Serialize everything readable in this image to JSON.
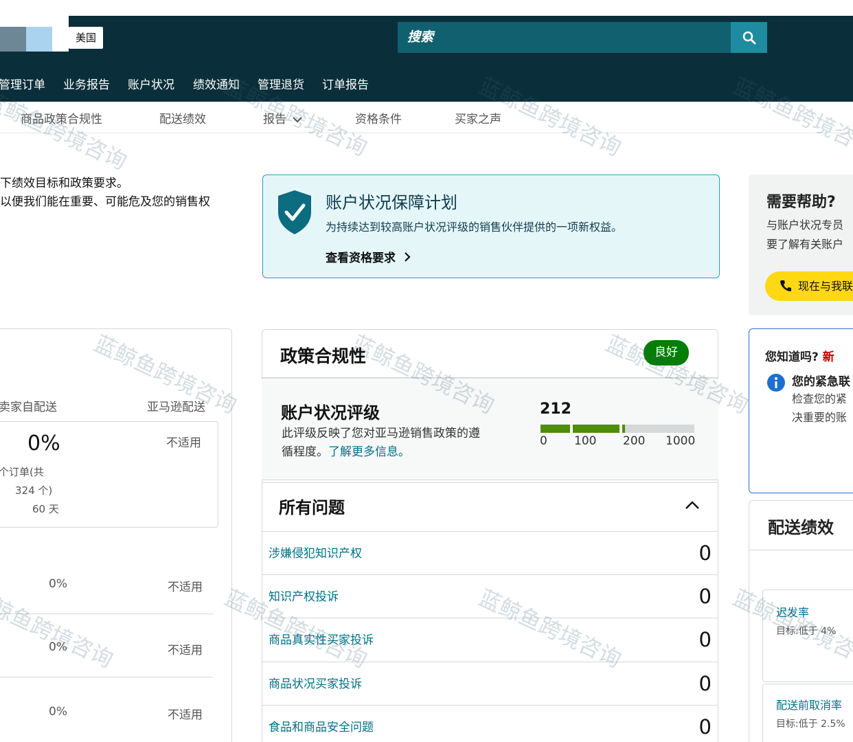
{
  "header": {
    "country": "美国",
    "search_placeholder": "搜索"
  },
  "nav": {
    "items": [
      "管理订单",
      "业务报告",
      "账户状况",
      "绩效通知",
      "管理退货",
      "订单报告"
    ]
  },
  "subnav": {
    "items": [
      "商品政策合规性",
      "配送绩效",
      "报告",
      "资格条件",
      "买家之声"
    ]
  },
  "intro": {
    "line1": "下绩效目标和政策要求。",
    "line2": "以便我们能在重要、可能危及您的销售权"
  },
  "ahp": {
    "title": "账户状况保障计划",
    "desc": "为持续达到较高账户状况评级的销售伙伴提供的一项新权益。",
    "link": "查看资格要求"
  },
  "help": {
    "title": "需要帮助?",
    "desc1": "与账户状况专员",
    "desc2": "要了解有关账户",
    "button": "现在与我联"
  },
  "left_card": {
    "col1": "卖家自配送",
    "col2": "亚马逊配送",
    "main_pct": "0%",
    "na": "不适用",
    "orders_line1": "个订单(共",
    "orders_line2": "324 个)",
    "days": "60 天",
    "rows": [
      {
        "pct": "0%",
        "na": "不适用"
      },
      {
        "pct": "0%",
        "na": "不适用"
      },
      {
        "pct": "0%",
        "na": "不适用"
      }
    ]
  },
  "policy": {
    "title": "政策合规性",
    "badge": "良好",
    "rating_title": "账户状况评级",
    "rating_desc1": "此评级反映了您对亚马逊销售政策的遵",
    "rating_desc2": "循程度。",
    "rating_link": "了解更多信息。",
    "score": "212",
    "score_value": 212,
    "ticks": [
      "0",
      "100",
      "200",
      "1000"
    ],
    "bar_colors": {
      "filled": "#4e8d0e",
      "empty": "#d5d9d9"
    }
  },
  "issues": {
    "title": "所有问题",
    "rows": [
      {
        "label": "涉嫌侵犯知识产权",
        "count": "0"
      },
      {
        "label": "知识产权投诉",
        "count": "0"
      },
      {
        "label": "商品真实性买家投诉",
        "count": "0"
      },
      {
        "label": "商品状况买家投诉",
        "count": "0"
      },
      {
        "label": "食品和商品安全问题",
        "count": "0"
      }
    ]
  },
  "dyk": {
    "title": "您知道吗?",
    "new": "新",
    "sub": "您的紧急联",
    "text1": "检查您的紧",
    "text2": "决重要的账"
  },
  "shipping": {
    "title": "配送绩效",
    "metrics": [
      {
        "label": "迟发率",
        "target": "目标:低于 4%"
      },
      {
        "label": "配送前取消率",
        "target": "目标:低于 2.5%"
      }
    ]
  },
  "watermark": "蓝鲸鱼跨境咨询"
}
